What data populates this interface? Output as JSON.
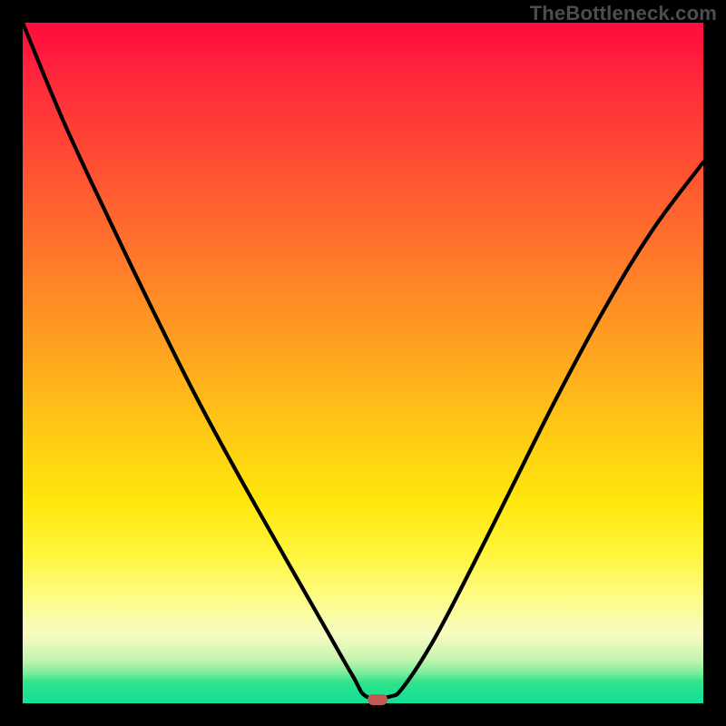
{
  "watermark": "TheBottleneck.com",
  "colors": {
    "background": "#000000",
    "gradient_top": "#ff0b3e",
    "gradient_mid": "#ffe60b",
    "gradient_bottom": "#12e09a",
    "curve": "#000000",
    "marker": "#c15955",
    "watermark": "#4d4d4d"
  },
  "marker": {
    "x_frac": 0.521,
    "y_frac": 0.994
  },
  "chart_data": {
    "type": "line",
    "title": "",
    "xlabel": "",
    "ylabel": "",
    "xlim": [
      0,
      1
    ],
    "ylim": [
      0,
      1
    ],
    "series": [
      {
        "name": "bottleneck-curve",
        "x": [
          0.0,
          0.06,
          0.125,
          0.19,
          0.255,
          0.32,
          0.385,
          0.445,
          0.485,
          0.505,
          0.54,
          0.56,
          0.605,
          0.66,
          0.72,
          0.785,
          0.855,
          0.925,
          1.0
        ],
        "y": [
          1.0,
          0.855,
          0.715,
          0.58,
          0.45,
          0.33,
          0.215,
          0.11,
          0.04,
          0.01,
          0.01,
          0.025,
          0.095,
          0.2,
          0.32,
          0.45,
          0.58,
          0.695,
          0.795
        ]
      }
    ],
    "annotations": [
      {
        "type": "marker",
        "shape": "rounded-rect",
        "x": 0.521,
        "y": 0.006,
        "color": "#c15955"
      }
    ],
    "background_gradient": {
      "direction": "vertical",
      "stops": [
        {
          "pos": 0.0,
          "color": "#ff0b3e"
        },
        {
          "pos": 0.5,
          "color": "#ffc915"
        },
        {
          "pos": 0.85,
          "color": "#fdfc8d"
        },
        {
          "pos": 1.0,
          "color": "#12e09a"
        }
      ]
    }
  }
}
